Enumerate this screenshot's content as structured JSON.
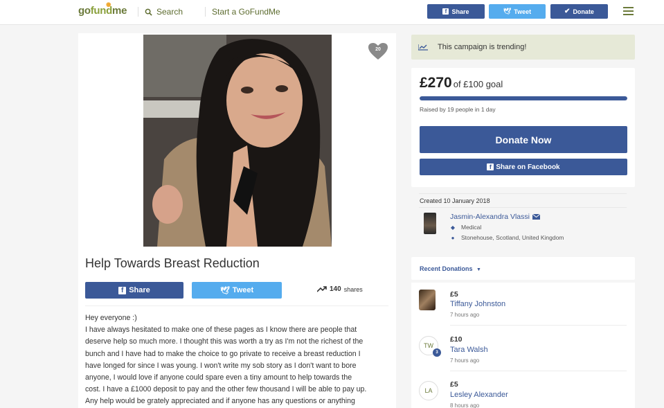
{
  "header": {
    "logo_go": "go",
    "logo_fund": "fund",
    "logo_me": "me",
    "search_label": "Search",
    "start_label": "Start a GoFundMe",
    "share_label": "Share",
    "tweet_label": "Tweet",
    "donate_label": "Donate"
  },
  "campaign": {
    "heart_count": "20",
    "title": "Help Towards Breast Reduction",
    "share_label": "Share",
    "tweet_label": "Tweet",
    "shares_count": "140",
    "shares_label": "shares",
    "story": [
      "Hey everyone :)",
      "I have always hesitated to make one of these pages as I know there are people that",
      "deserve help so much more. I thought this was worth a try as I'm not the richest of the",
      "bunch and I have had to make the choice to go private to receive a breast reduction I",
      "have longed for since I was young. I won't write my sob story as I don't want to bore",
      "anyone, I would love if anyone could spare even a tiny amount to help towards the",
      "cost. I have a £1000 deposit to pay and the other few thousand I will be able to pay up.",
      "Any help would be grately appreciated and if anyone has any questions or anything"
    ]
  },
  "sidebar": {
    "trending_text": "This campaign is trending!",
    "raised_amount": "£270",
    "goal_text": "of £100 goal",
    "progress_fraction": 1.0,
    "raised_by": "Raised by 19 people in 1 day",
    "donate_now_label": "Donate Now",
    "share_facebook_label": "Share on Facebook",
    "created": "Created 10 January 2018",
    "organizer_name": "Jasmin-Alexandra Vlassi",
    "organizer_category": "Medical",
    "organizer_location": "Stonehouse, Scotland, United Kingdom",
    "recent_donations_label": "Recent Donations",
    "donations": [
      {
        "amount": "£5",
        "name": "Tiffany Johnston",
        "time": "7 hours ago",
        "initials": "",
        "badge": ""
      },
      {
        "amount": "£10",
        "name": "Tara Walsh",
        "time": "7 hours ago",
        "initials": "TW",
        "badge": "3"
      },
      {
        "amount": "£5",
        "name": "Lesley Alexander",
        "time": "8 hours ago",
        "initials": "LA",
        "badge": ""
      }
    ]
  },
  "colors": {
    "facebook_blue": "#3b5998",
    "twitter_blue": "#55acee",
    "brand_green": "#6b7a3a",
    "trend_bg": "#e6e9d7"
  },
  "icons": [
    "search-icon",
    "facebook-icon",
    "twitter-icon",
    "check-icon",
    "menu-icon",
    "heart-icon",
    "trending-icon",
    "envelope-icon",
    "tag-icon",
    "location-pin-icon",
    "chevron-down-icon"
  ]
}
